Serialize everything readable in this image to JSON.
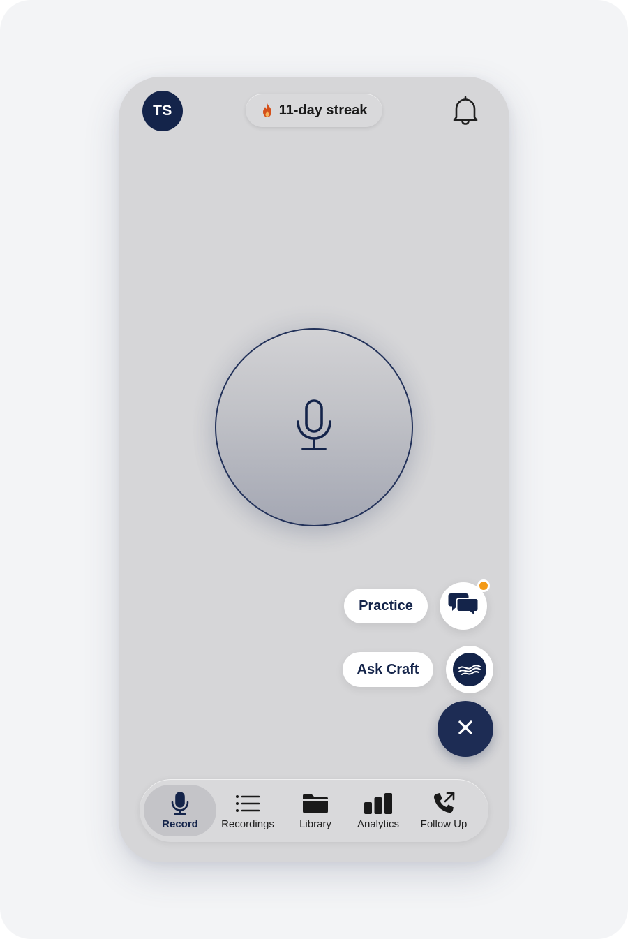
{
  "header": {
    "avatar_initials": "TS",
    "streak_label": "11-day streak",
    "streak_icon": "flame-icon",
    "notifications_icon": "bell-icon"
  },
  "main": {
    "record_button_icon": "microphone-icon"
  },
  "actions": {
    "practice_label": "Practice",
    "practice_icon": "chat-bubbles-icon",
    "practice_has_notification": true,
    "ask_craft_label": "Ask Craft",
    "ask_craft_icon": "craft-wave-logo",
    "close_icon": "close-icon"
  },
  "nav": {
    "items": [
      {
        "label": "Record",
        "icon": "microphone-icon",
        "active": true
      },
      {
        "label": "Recordings",
        "icon": "list-icon",
        "active": false
      },
      {
        "label": "Library",
        "icon": "folder-icon",
        "active": false
      },
      {
        "label": "Analytics",
        "icon": "bar-chart-icon",
        "active": false
      },
      {
        "label": "Follow Up",
        "icon": "phone-outgoing-icon",
        "active": false
      }
    ]
  },
  "colors": {
    "brand_navy": "#14244a",
    "notification_orange": "#f39a17",
    "flame": "#d4501a",
    "phone_background": "#d6d6d8"
  }
}
